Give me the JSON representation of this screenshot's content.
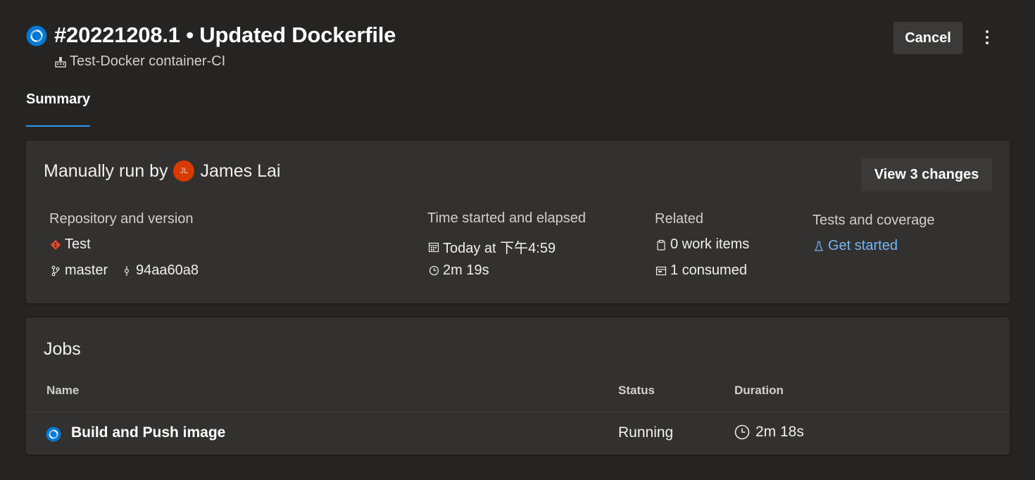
{
  "header": {
    "run_title": "#20221208.1 • Updated Dockerfile",
    "pipeline_name": "Test-Docker container-CI",
    "cancel_label": "Cancel",
    "status_color": "#0078d4"
  },
  "tabs": [
    {
      "label": "Summary",
      "active": true
    }
  ],
  "summary": {
    "run_by_prefix": "Manually run by",
    "user_initials": "JL",
    "user_name": "James Lai",
    "view_changes_label": "View 3 changes",
    "repository": {
      "header": "Repository and version",
      "repo_name": "Test",
      "branch": "master",
      "commit": "94aa60a8"
    },
    "time": {
      "header": "Time started and elapsed",
      "started": "Today at 下午4:59",
      "elapsed": "2m 19s"
    },
    "related": {
      "header": "Related",
      "work_items": "0 work items",
      "consumed": "1 consumed"
    },
    "tests": {
      "header": "Tests and coverage",
      "link": "Get started"
    }
  },
  "jobs": {
    "title": "Jobs",
    "columns": [
      "Name",
      "Status",
      "Duration"
    ],
    "rows": [
      {
        "name": "Build and Push image",
        "status": "Running",
        "duration": "2m 18s"
      }
    ]
  },
  "icons": {
    "run_status": "running-status-icon",
    "pipeline": "pipeline-icon",
    "repo": "git-repo-icon",
    "branch": "branch-icon",
    "commit": "commit-icon",
    "calendar": "calendar-icon",
    "clock": "clock-icon",
    "work_item": "work-item-icon",
    "artifact": "artifact-icon",
    "flask": "flask-icon"
  }
}
